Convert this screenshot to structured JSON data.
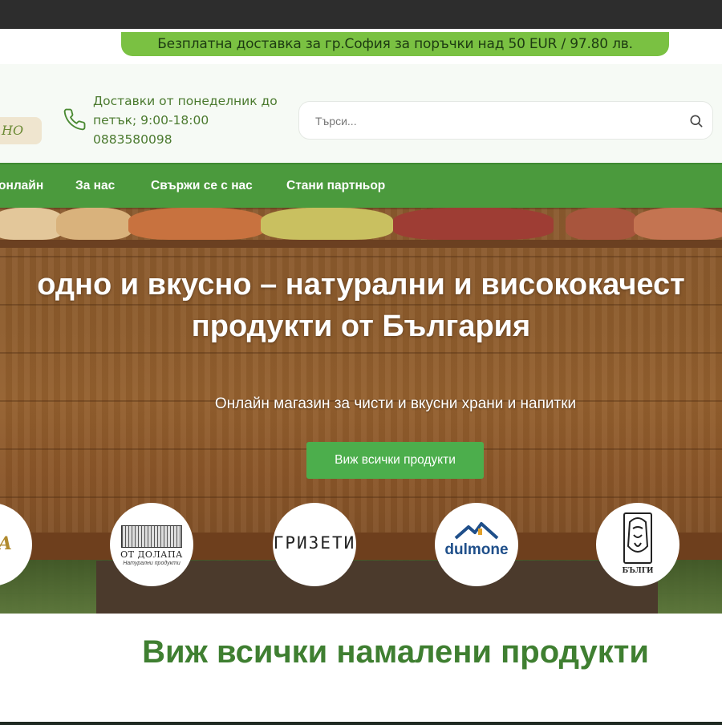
{
  "promo_bar": {
    "text": "Безплатна доставка за гр.София за поръчки над 50 EUR / 97.80 лв."
  },
  "header": {
    "logo_partial": "НО",
    "delivery_line1": "Доставки от понеделник до",
    "delivery_line2": "петък; 9:00-18:00",
    "phone": "0883580098",
    "search_placeholder": "Търси..."
  },
  "nav": {
    "items": [
      {
        "label": "онлайн"
      },
      {
        "label": "За нас"
      },
      {
        "label": "Свържи се с нас"
      },
      {
        "label": "Стани партньор"
      }
    ]
  },
  "hero": {
    "title_line1": "одно и вкусно – натурални и висококачест",
    "title_line2": "продукти от България",
    "subtitle": "Онлайн магазин за чисти и вкусни храни и напитки",
    "button_label": "Виж всички продукти"
  },
  "brands": [
    {
      "name": "НА"
    },
    {
      "name": "ОТ ДОЛАПА",
      "tagline": "Натурални продукти"
    },
    {
      "name": "ГРИЗЕТИ"
    },
    {
      "name": "dulmone"
    },
    {
      "name": "БЪЛГИ"
    }
  ],
  "section": {
    "discounts_title": "Виж всички намалени продукти"
  },
  "colors": {
    "brand_green": "#4b9a3d",
    "promo_green": "#7ac142",
    "button_green": "#4cae4c",
    "title_green": "#3f7f31"
  }
}
